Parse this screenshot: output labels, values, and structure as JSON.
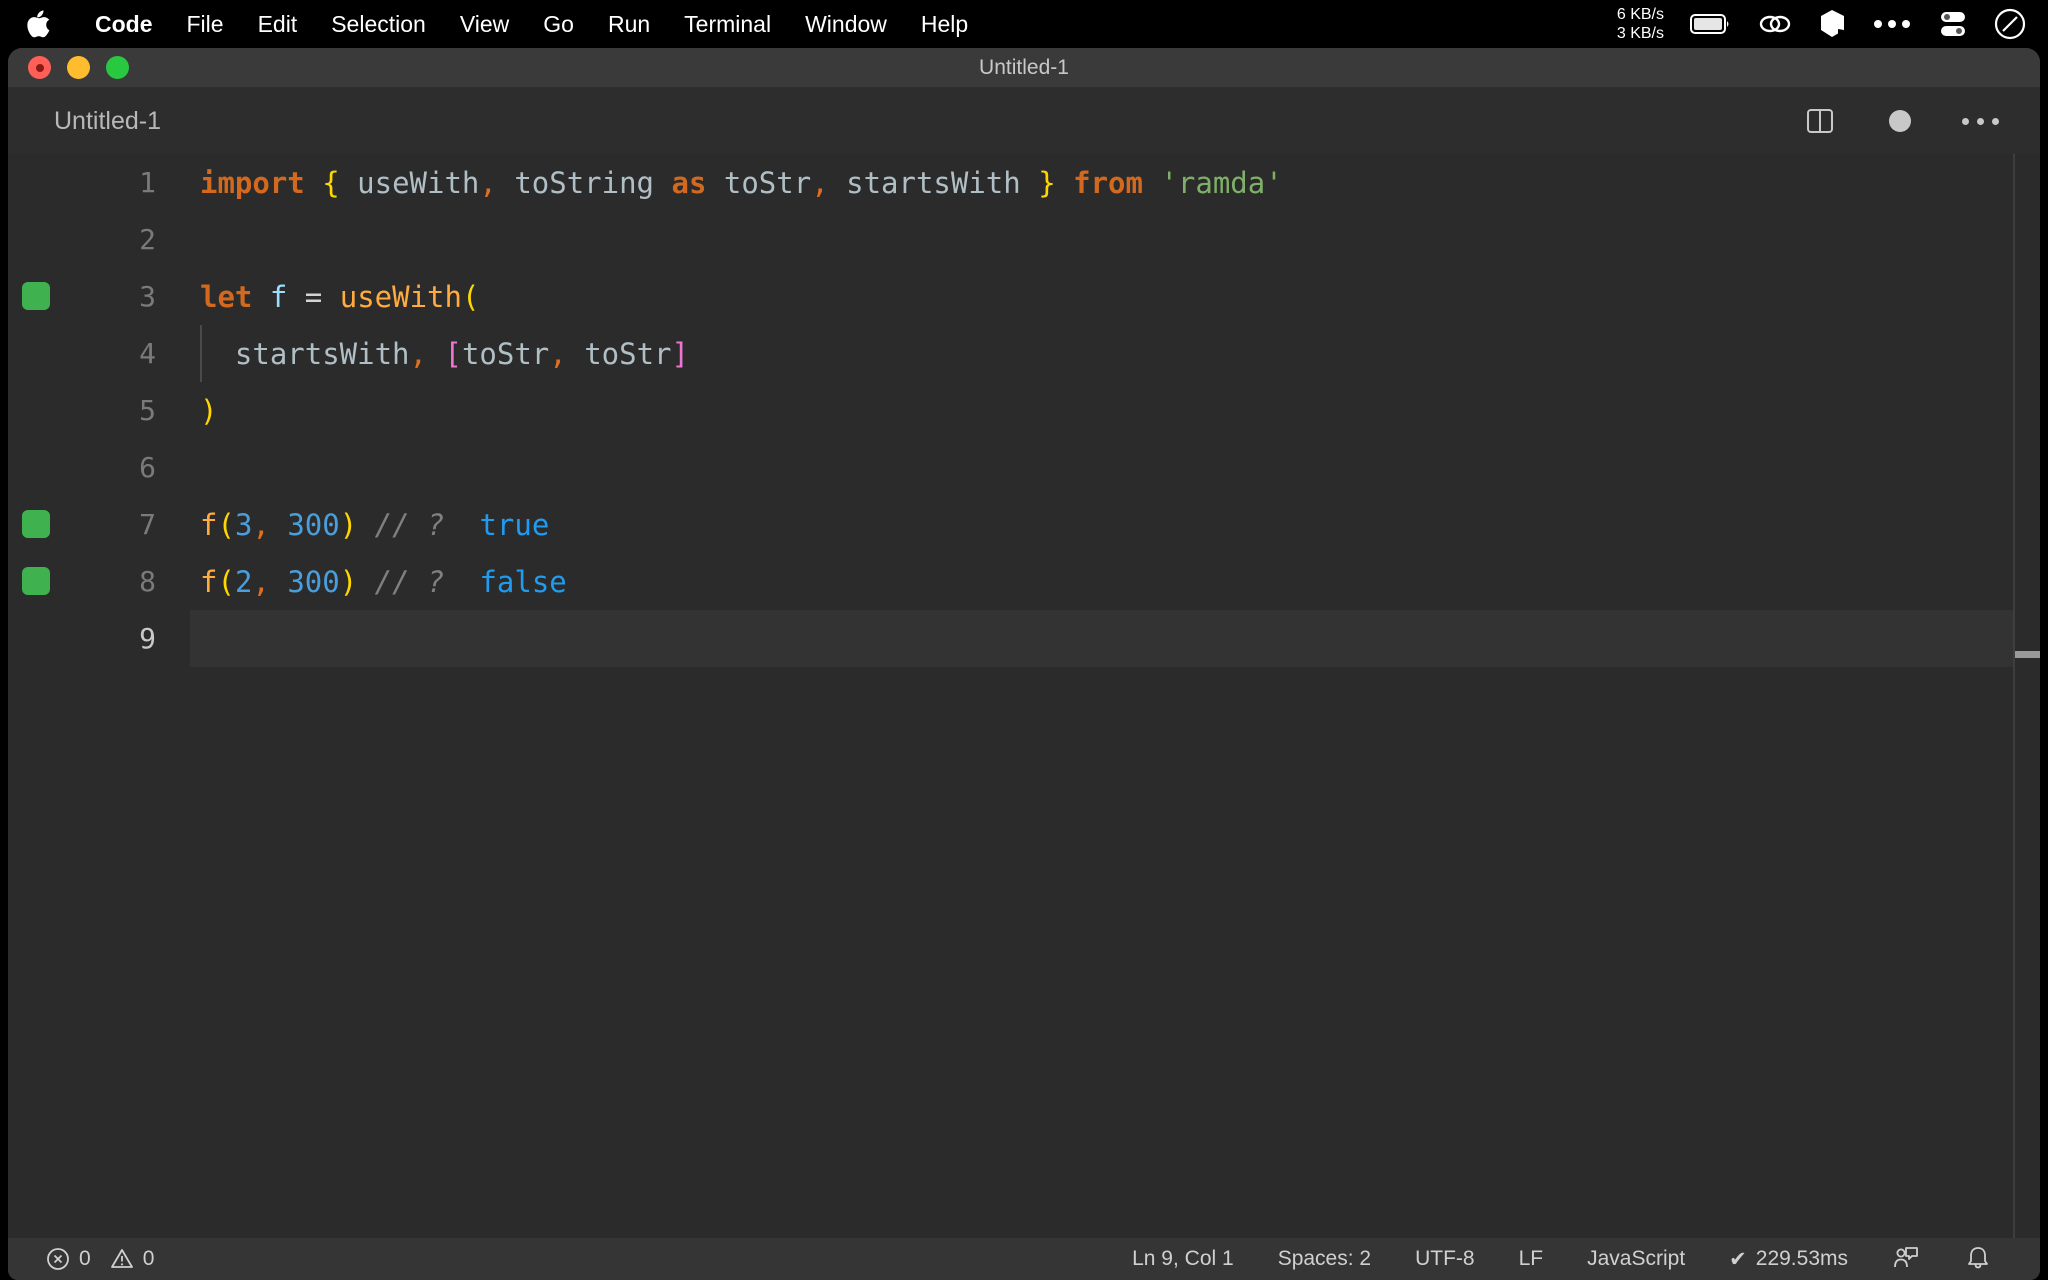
{
  "menubar": {
    "apple_icon": "apple-logo-icon",
    "items": [
      {
        "label": "Code",
        "bold": true
      },
      {
        "label": "File",
        "bold": false
      },
      {
        "label": "Edit",
        "bold": false
      },
      {
        "label": "Selection",
        "bold": false
      },
      {
        "label": "View",
        "bold": false
      },
      {
        "label": "Go",
        "bold": false
      },
      {
        "label": "Run",
        "bold": false
      },
      {
        "label": "Terminal",
        "bold": false
      },
      {
        "label": "Window",
        "bold": false
      },
      {
        "label": "Help",
        "bold": false
      }
    ],
    "network_up": "6 KB/s",
    "network_down": "3 KB/s",
    "status_icons": [
      "battery-icon",
      "link-chain-icon",
      "cube-icon",
      "ellipsis-icon",
      "control-center-icon",
      "do-not-disturb-icon"
    ]
  },
  "window": {
    "title": "Untitled-1",
    "traffic_lights": [
      "close",
      "minimize",
      "maximize"
    ],
    "unsaved": true
  },
  "tabstrip": {
    "tab_label": "Untitled-1",
    "actions": [
      "split-editor-icon",
      "unsaved-dot-icon",
      "more-actions-icon"
    ]
  },
  "editor": {
    "language": "JavaScript",
    "lines": [
      {
        "number": "1",
        "marker": false,
        "indent_guide": false,
        "current": false,
        "tokens": [
          {
            "text": "import",
            "cls": "t-kw"
          },
          {
            "text": " ",
            "cls": "t-op"
          },
          {
            "text": "{",
            "cls": "t-brace-y"
          },
          {
            "text": " ",
            "cls": "t-op"
          },
          {
            "text": "useWith",
            "cls": "t-ident"
          },
          {
            "text": ",",
            "cls": "t-comma"
          },
          {
            "text": " ",
            "cls": "t-op"
          },
          {
            "text": "toString",
            "cls": "t-ident"
          },
          {
            "text": " ",
            "cls": "t-op"
          },
          {
            "text": "as",
            "cls": "t-kw"
          },
          {
            "text": " ",
            "cls": "t-op"
          },
          {
            "text": "toStr",
            "cls": "t-ident"
          },
          {
            "text": ",",
            "cls": "t-comma"
          },
          {
            "text": " ",
            "cls": "t-op"
          },
          {
            "text": "startsWith",
            "cls": "t-ident"
          },
          {
            "text": " ",
            "cls": "t-op"
          },
          {
            "text": "}",
            "cls": "t-brace-y"
          },
          {
            "text": " ",
            "cls": "t-op"
          },
          {
            "text": "from",
            "cls": "t-kw"
          },
          {
            "text": " ",
            "cls": "t-op"
          },
          {
            "text": "'ramda'",
            "cls": "t-str"
          }
        ]
      },
      {
        "number": "2",
        "marker": false,
        "indent_guide": false,
        "current": false,
        "tokens": []
      },
      {
        "number": "3",
        "marker": true,
        "indent_guide": false,
        "current": false,
        "tokens": [
          {
            "text": "let",
            "cls": "t-kw"
          },
          {
            "text": " ",
            "cls": "t-op"
          },
          {
            "text": "f",
            "cls": "t-var"
          },
          {
            "text": " ",
            "cls": "t-op"
          },
          {
            "text": "=",
            "cls": "t-op"
          },
          {
            "text": " ",
            "cls": "t-op"
          },
          {
            "text": "useWith",
            "cls": "t-fn"
          },
          {
            "text": "(",
            "cls": "t-brace-y"
          }
        ]
      },
      {
        "number": "4",
        "marker": false,
        "indent_guide": true,
        "current": false,
        "tokens": [
          {
            "text": "  ",
            "cls": "t-op"
          },
          {
            "text": "startsWith",
            "cls": "t-ident"
          },
          {
            "text": ",",
            "cls": "t-comma"
          },
          {
            "text": " ",
            "cls": "t-op"
          },
          {
            "text": "[",
            "cls": "t-brace-m"
          },
          {
            "text": "toStr",
            "cls": "t-ident"
          },
          {
            "text": ",",
            "cls": "t-comma"
          },
          {
            "text": " ",
            "cls": "t-op"
          },
          {
            "text": "toStr",
            "cls": "t-ident"
          },
          {
            "text": "]",
            "cls": "t-brace-m"
          }
        ]
      },
      {
        "number": "5",
        "marker": false,
        "indent_guide": false,
        "current": false,
        "tokens": [
          {
            "text": ")",
            "cls": "t-brace-y"
          }
        ]
      },
      {
        "number": "6",
        "marker": false,
        "indent_guide": false,
        "current": false,
        "tokens": []
      },
      {
        "number": "7",
        "marker": true,
        "indent_guide": false,
        "current": false,
        "tokens": [
          {
            "text": "f",
            "cls": "t-fn"
          },
          {
            "text": "(",
            "cls": "t-brace-y"
          },
          {
            "text": "3",
            "cls": "t-num"
          },
          {
            "text": ",",
            "cls": "t-comma"
          },
          {
            "text": " ",
            "cls": "t-op"
          },
          {
            "text": "300",
            "cls": "t-num"
          },
          {
            "text": ")",
            "cls": "t-brace-y"
          },
          {
            "text": " ",
            "cls": "t-op"
          },
          {
            "text": "// ?",
            "cls": "t-comment"
          },
          {
            "text": "  ",
            "cls": "t-op"
          },
          {
            "text": "true",
            "cls": "t-val"
          }
        ]
      },
      {
        "number": "8",
        "marker": true,
        "indent_guide": false,
        "current": false,
        "tokens": [
          {
            "text": "f",
            "cls": "t-fn"
          },
          {
            "text": "(",
            "cls": "t-brace-y"
          },
          {
            "text": "2",
            "cls": "t-num"
          },
          {
            "text": ",",
            "cls": "t-comma"
          },
          {
            "text": " ",
            "cls": "t-op"
          },
          {
            "text": "300",
            "cls": "t-num"
          },
          {
            "text": ")",
            "cls": "t-brace-y"
          },
          {
            "text": " ",
            "cls": "t-op"
          },
          {
            "text": "// ?",
            "cls": "t-comment"
          },
          {
            "text": "  ",
            "cls": "t-op"
          },
          {
            "text": "false",
            "cls": "t-val"
          }
        ]
      },
      {
        "number": "9",
        "marker": false,
        "indent_guide": false,
        "current": true,
        "tokens": []
      }
    ]
  },
  "statusbar": {
    "errors": "0",
    "warnings": "0",
    "cursor": "Ln 9, Col 1",
    "indentation": "Spaces: 2",
    "encoding": "UTF-8",
    "eol": "LF",
    "language": "JavaScript",
    "runtime": "229.53ms",
    "runtime_check": "✔",
    "right_icons": [
      "feedback-icon",
      "notifications-bell-icon"
    ]
  },
  "colors": {
    "menubar_bg": "#000000",
    "titlebar_bg": "#3a3a3a",
    "editor_bg": "#2b2b2b",
    "statusbar_bg": "#353535",
    "marker_green": "#3fb24f",
    "keyword_orange": "#d2691e",
    "bracket_yellow": "#ffd700",
    "bracket_magenta": "#f075d0",
    "string_green": "#7fb069",
    "number_blue": "#4a9edb",
    "value_blue": "#1f9cf0"
  }
}
